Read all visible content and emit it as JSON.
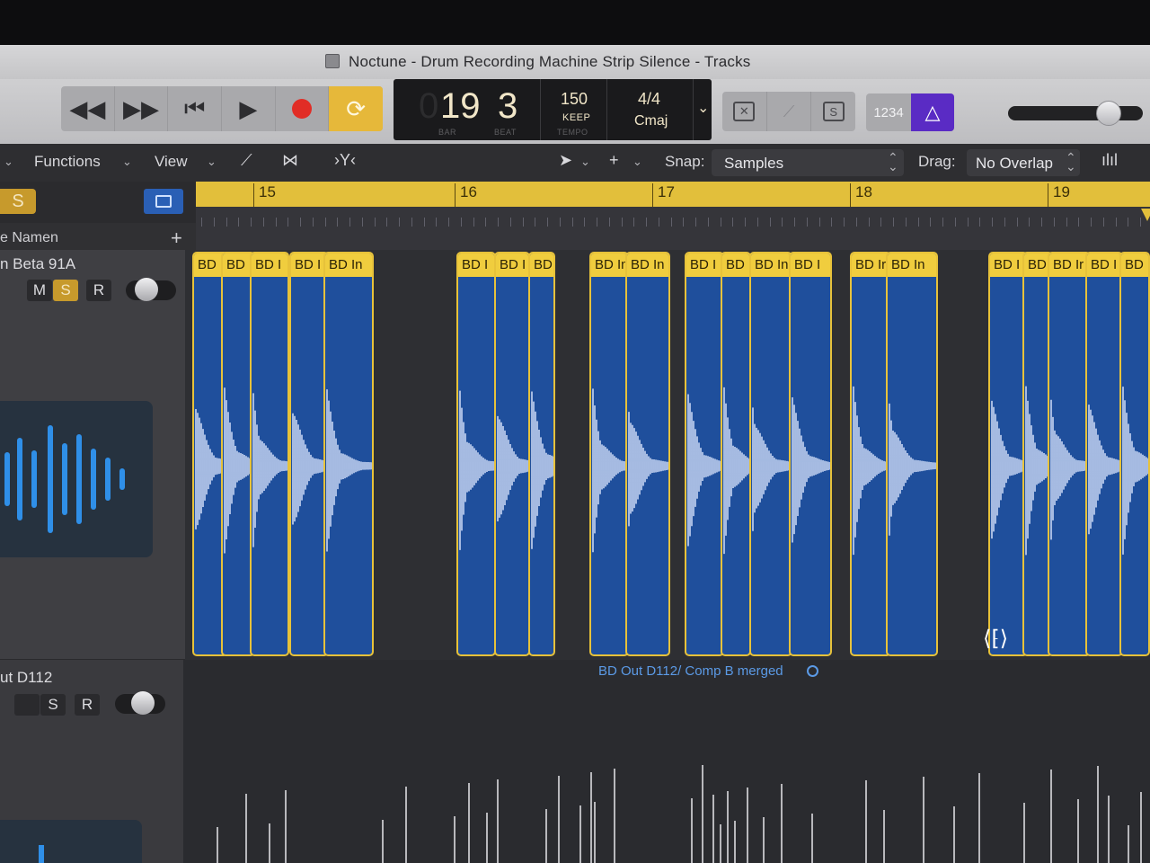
{
  "window": {
    "title": "Noctune - Drum Recording Machine Strip Silence - Tracks"
  },
  "transport": {
    "rewind_icon": "rewind-icon",
    "forward_icon": "fast-forward-icon",
    "to_start_icon": "go-to-start-icon",
    "play_icon": "play-icon",
    "record_icon": "record-icon",
    "cycle_icon": "cycle-icon"
  },
  "lcd": {
    "bar_dim": "0",
    "bar": "19",
    "beat": "3",
    "bar_label": "BAR",
    "beat_label": "BEAT",
    "tempo": "150",
    "keep": "KEEP",
    "tempo_label": "TEMPO",
    "signature": "4/4",
    "key": "Cmaj"
  },
  "count_in": {
    "label": "1234"
  },
  "solo_label": "S",
  "menu": {
    "functions": "Functions",
    "view": "View"
  },
  "snap": {
    "label": "Snap:",
    "value": "Samples"
  },
  "drag": {
    "label": "Drag:",
    "value": "No Overlap"
  },
  "track_header": {
    "name_col": "e Namen",
    "add": "+"
  },
  "tracks": [
    {
      "name": "n Beta 91A",
      "mute": "M",
      "solo": "S",
      "record": "R"
    },
    {
      "name": "ut D112",
      "solo": "S",
      "record": "R"
    }
  ],
  "ruler": {
    "bars": [
      "15",
      "16",
      "17",
      "18",
      "19"
    ]
  },
  "regions": [
    "BD In",
    "BD I",
    "BD I",
    "BD I",
    "BD In",
    "BD I",
    "BD I",
    "BD",
    "BD In",
    "BD In",
    "BD I",
    "BD",
    "BD In",
    "BD I",
    "BD Ir",
    "BD In",
    "BD I",
    "BD I",
    "BD Ir",
    "BD I",
    "BD"
  ],
  "merged_region": {
    "label": "BD Out D112/ Comp B merged"
  },
  "colors": {
    "region_header": "#f0cd3e",
    "region_body": "#1f4f9c",
    "accent_purple": "#5a2bc4",
    "solo_yellow": "#c79a2c"
  }
}
